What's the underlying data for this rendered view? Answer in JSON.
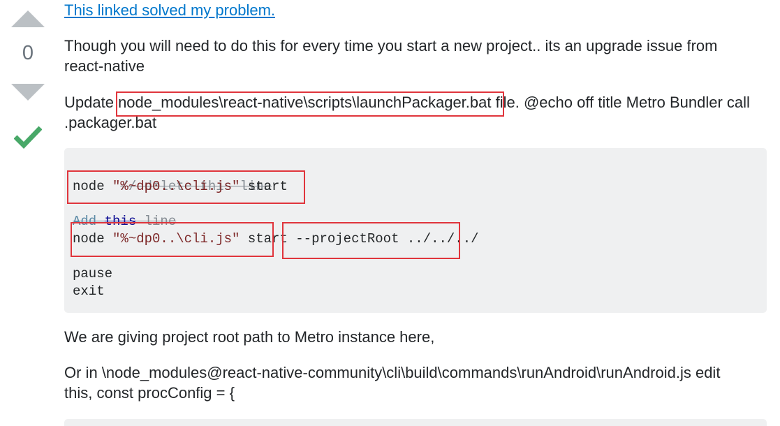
{
  "vote": {
    "count": "0"
  },
  "post": {
    "link_text": "This linked solved my problem.",
    "p1_line1": "Though you will need to do this for every time you start a new project.. its an upgrade issue from",
    "p1_line2": "react-native",
    "p2_prefix": "Update ",
    "p2_path": "node_modules\\react-native\\scripts\\launchPackager.bat",
    "p2_suffix": " file. @echo off title Metro Bundler call",
    "p2_line2": ".packager.bat",
    "p3": "We are giving project root path to Metro instance here,",
    "p4_line1": "Or in \\node_modules@react-native-community\\cli\\build\\commands\\runAndroid\\runAndroid.js edit",
    "p4_line2": "this, const procConfig = {"
  },
  "code": {
    "comment1": "// delete this line",
    "line1_cmd": "node ",
    "line1_str": "\"%~dp0..\\cli.js\"",
    "line1_rest": " start",
    "comment2_a": "Add ",
    "comment2_b": "this",
    "comment2_c": " line",
    "line2_cmd": "node ",
    "line2_str": "\"%~dp0..\\cli.js\"",
    "line2_rest": " start --projectRoot ../../../",
    "line3": "pause",
    "line4": "exit"
  },
  "colors": {
    "accent_link": "#0077cc",
    "accepted_green": "#48a868",
    "highlight_red": "#e0353c",
    "code_bg": "#eff0f1"
  }
}
